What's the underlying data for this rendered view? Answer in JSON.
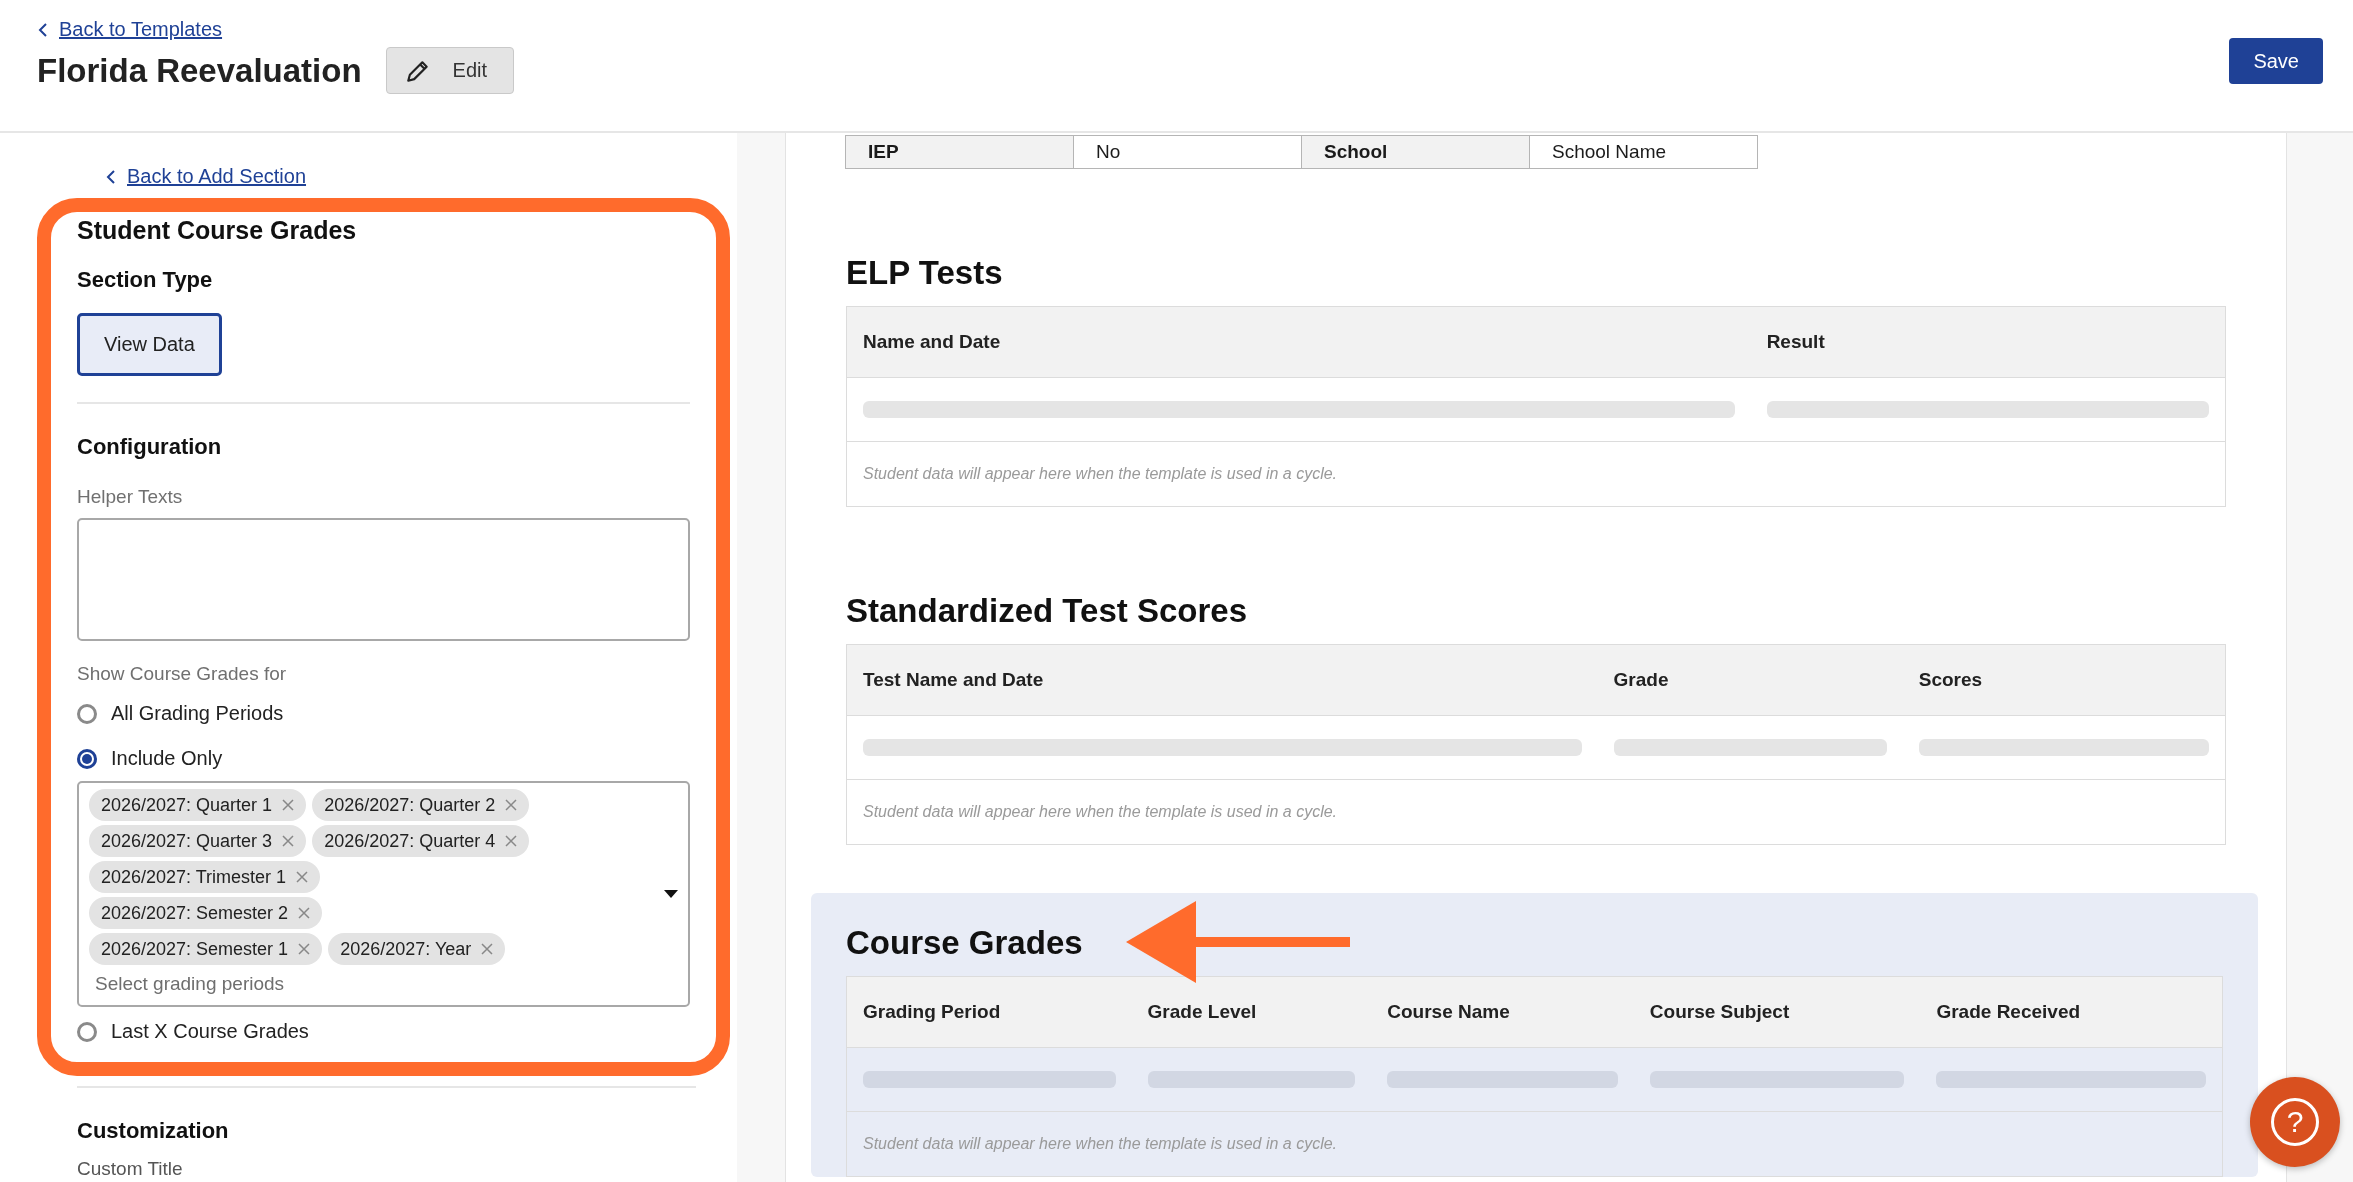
{
  "header": {
    "back_link": "Back to Templates",
    "title": "Florida Reevaluation",
    "edit_button": "Edit",
    "save_button": "Save"
  },
  "sidebar": {
    "back_link": "Back to Add Section",
    "section_title": "Student Course Grades",
    "section_type_label": "Section Type",
    "section_types": [
      {
        "label": "View Data",
        "selected": true
      }
    ],
    "configuration_heading": "Configuration",
    "helper_texts_label": "Helper Texts",
    "show_for_label": "Show Course Grades for",
    "items": [
      {
        "kind": "radio",
        "label": "All Grading Periods",
        "selected": false
      },
      {
        "kind": "radio",
        "label": "Include Only",
        "selected": true
      },
      {
        "kind": "multiselect",
        "placeholder": "Select grading periods",
        "chips": [
          "2026/2027: Quarter 1",
          "2026/2027: Quarter 2",
          "2026/2027: Quarter 3",
          "2026/2027: Quarter 4",
          "2026/2027: Trimester 1",
          "2026/2027: Semester 2",
          "2026/2027: Semester 1",
          "2026/2027: Year"
        ]
      },
      {
        "kind": "radio",
        "label": "Last X Course Grades",
        "selected": false
      }
    ],
    "customization_heading": "Customization",
    "custom_title_label": "Custom Title"
  },
  "document": {
    "info_row": [
      {
        "kind": "label",
        "text": "IEP"
      },
      {
        "kind": "value",
        "text": "No"
      },
      {
        "kind": "label",
        "text": "School"
      },
      {
        "kind": "value",
        "text": "School Name"
      }
    ],
    "sections": [
      {
        "title": "ELP Tests",
        "highlighted": false,
        "columns": [
          "Name and Date",
          "Result"
        ],
        "note": "Student data will appear here when the template is used in a cycle."
      },
      {
        "title": "Standardized Test Scores",
        "highlighted": false,
        "columns": [
          "Test Name and Date",
          "Grade",
          "Scores"
        ],
        "note": "Student data will appear here when the template is used in a cycle."
      },
      {
        "title": "Course Grades",
        "highlighted": true,
        "columns": [
          "Grading Period",
          "Grade Level",
          "Course Name",
          "Course Subject",
          "Grade Received"
        ],
        "note": "Student data will appear here when the template is used in a cycle."
      }
    ]
  },
  "help_button": "?"
}
